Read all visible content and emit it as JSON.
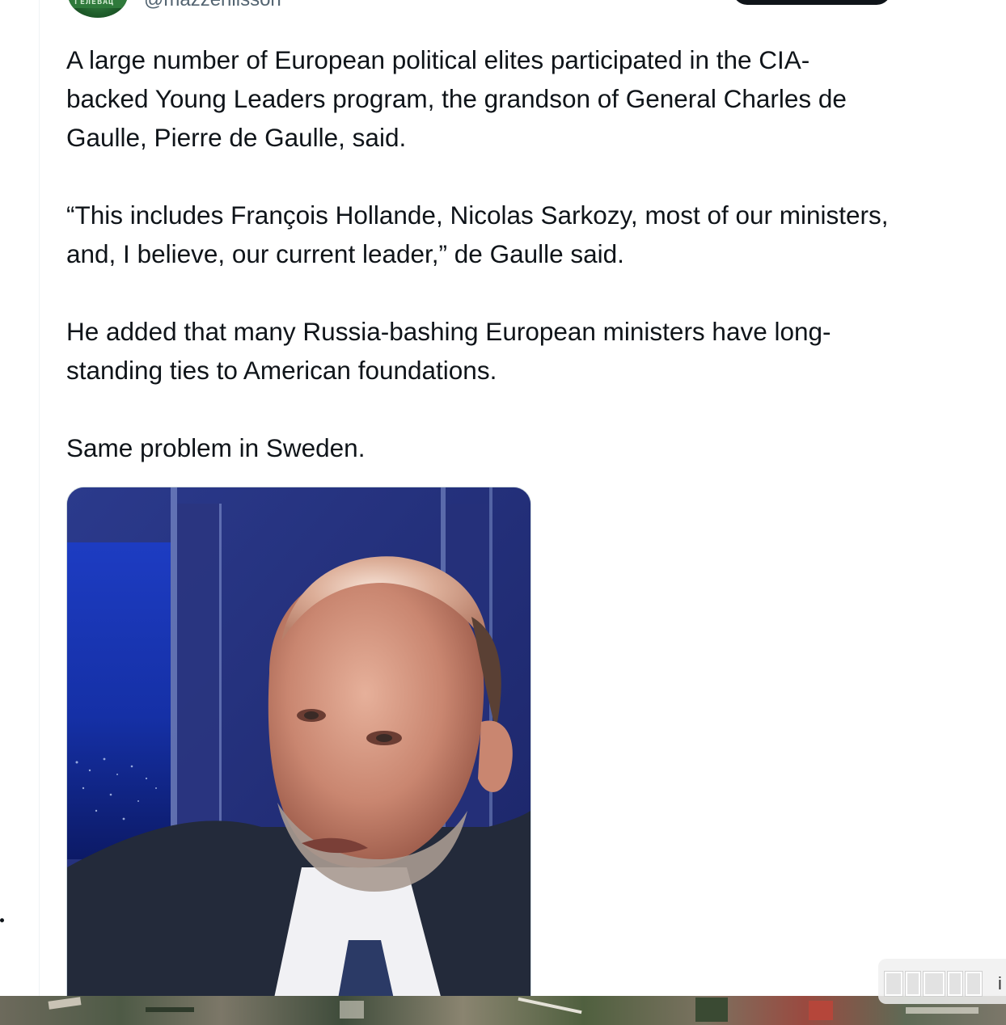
{
  "author": {
    "handle": "@mazzenilsson",
    "avatar_text": "ГЕЛЕВАЦ"
  },
  "tweet": {
    "paragraphs": [
      "A large number of European political elites participated in the CIA-\nbacked Young Leaders program, the grandson of General Charles de\nGaulle, Pierre de Gaulle, said.",
      "“This includes François Hollande, Nicolas Sarkozy, most of our ministers,\nand, I believe, our current leader,” de Gaulle said.",
      "He added that many Russia-bashing European ministers have long-\nstanding ties to American foundations.",
      "Same problem in Sweden."
    ]
  },
  "media": {
    "icon": "photo-of-man-in-tv-studio"
  },
  "watermark": {
    "tail_text": "i"
  },
  "colors": {
    "text": "#0f1419",
    "muted": "#536471",
    "border": "#cfd9de",
    "studio_blue": "#22307c"
  }
}
